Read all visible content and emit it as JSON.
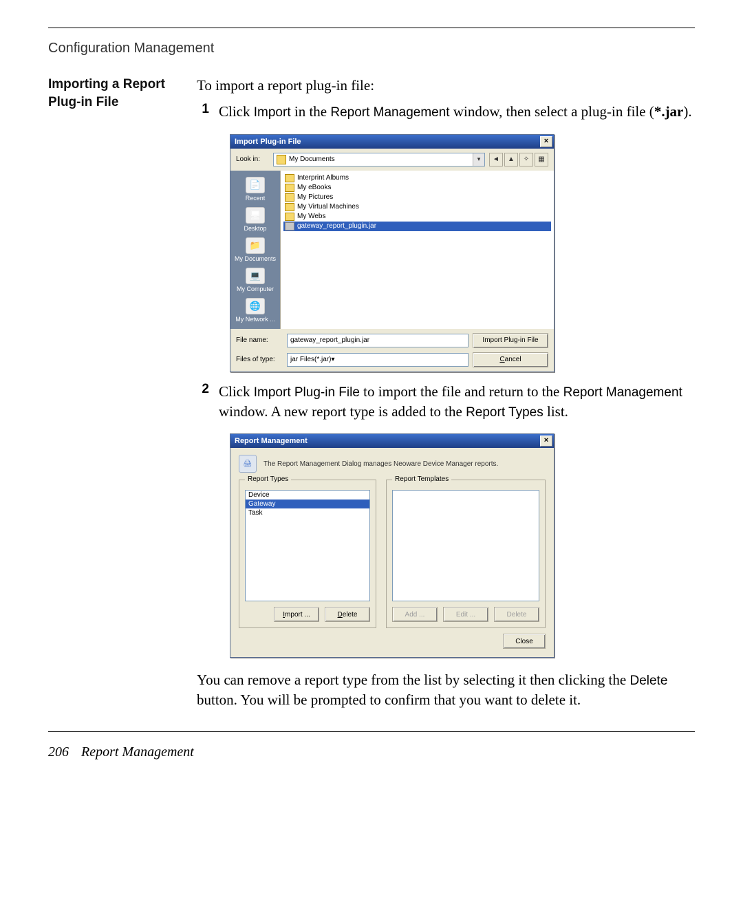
{
  "header": "Configuration Management",
  "sideHeading": "Importing a Report Plug-in File",
  "intro": "To import a report plug-in file:",
  "step1": {
    "num": "1",
    "a": "Click ",
    "b": "Import",
    "c": " in the ",
    "d": "Report Management",
    "e": " window, then select a plug-in file (",
    "f": "*.jar",
    "g": ")."
  },
  "dlg1": {
    "title": "Import Plug-in File",
    "lookinLabel": "Look in:",
    "lookinValue": "My Documents",
    "toolbar": {
      "back": "back-icon",
      "up": "up-one-level-icon",
      "newFolder": "new-folder-icon",
      "views": "views-icon"
    },
    "places": [
      "Recent",
      "Desktop",
      "My Documents",
      "My Computer",
      "My Network ..."
    ],
    "fileList": [
      {
        "name": "Interprint Albums",
        "type": "folder"
      },
      {
        "name": "My eBooks",
        "type": "folder"
      },
      {
        "name": "My Pictures",
        "type": "folder"
      },
      {
        "name": "My Virtual Machines",
        "type": "folder"
      },
      {
        "name": "My Webs",
        "type": "folder"
      },
      {
        "name": "gateway_report_plugin.jar",
        "type": "jar",
        "selected": true
      }
    ],
    "fileNameLabel": "File name:",
    "fileNameValue": "gateway_report_plugin.jar",
    "filesOfTypeLabel": "Files of type:",
    "filesOfTypeValue": "jar Files(*.jar)",
    "importBtn": "Import Plug-in File",
    "cancelBtn": "Cancel"
  },
  "step2": {
    "num": "2",
    "a": "Click ",
    "b": "Import Plug-in File",
    "c": " to import the file and return to the ",
    "d": "Report Management",
    "e": " window. A new report type is added to the ",
    "f": "Report Types",
    "g": " list."
  },
  "dlg2": {
    "title": "Report Management",
    "desc": "The Report Management Dialog manages Neoware Device Manager reports.",
    "group1": "Report Types",
    "group2": "Report Templates",
    "types": [
      "Device",
      "Gateway",
      "Task"
    ],
    "typesSelected": "Gateway",
    "importBtn": "Import ...",
    "deleteBtn": "Delete",
    "addBtn": "Add ...",
    "editBtn": "Edit ...",
    "deleteBtn2": "Delete",
    "closeBtn": "Close"
  },
  "removePara": {
    "a": "You can remove a report type from the list by selecting it then clicking the ",
    "b": "Delete",
    "c": " button. You will be prompted to confirm that you want to delete it."
  },
  "footer": {
    "pageNum": "206",
    "section": "Report Management"
  }
}
